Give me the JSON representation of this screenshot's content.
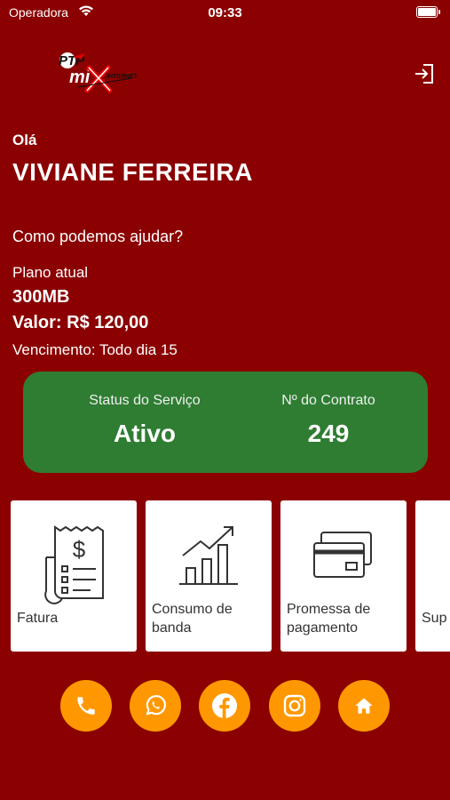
{
  "statusbar": {
    "carrier": "Operadora",
    "time": "09:33"
  },
  "header": {
    "logo_text": "PTP MIX INTERNET"
  },
  "greeting": {
    "hello": "Olá",
    "name": "VIVIANE FERREIRA",
    "prompt": "Como podemos ajudar?"
  },
  "plan": {
    "label": "Plano atual",
    "speed": "300MB",
    "price": "Valor: R$ 120,00",
    "due": "Vencimento: Todo dia 15"
  },
  "status_card": {
    "service_label": "Status do Serviço",
    "service_value": "Ativo",
    "contract_label": "Nº do Contrato",
    "contract_value": "249",
    "color": "#2E7D32"
  },
  "tiles": [
    {
      "label": "Fatura",
      "icon": "invoice-icon"
    },
    {
      "label": "Consumo de banda",
      "icon": "bar-chart-icon"
    },
    {
      "label": "Promessa de pagamento",
      "icon": "credit-card-icon"
    },
    {
      "label": "Sup",
      "icon": "support-icon"
    }
  ],
  "social": [
    {
      "icon": "phone-icon"
    },
    {
      "icon": "whatsapp-icon"
    },
    {
      "icon": "facebook-icon"
    },
    {
      "icon": "instagram-icon"
    },
    {
      "icon": "home-icon"
    }
  ],
  "colors": {
    "background": "#8B0000",
    "accent": "#FF9800",
    "success": "#2E7D32"
  }
}
